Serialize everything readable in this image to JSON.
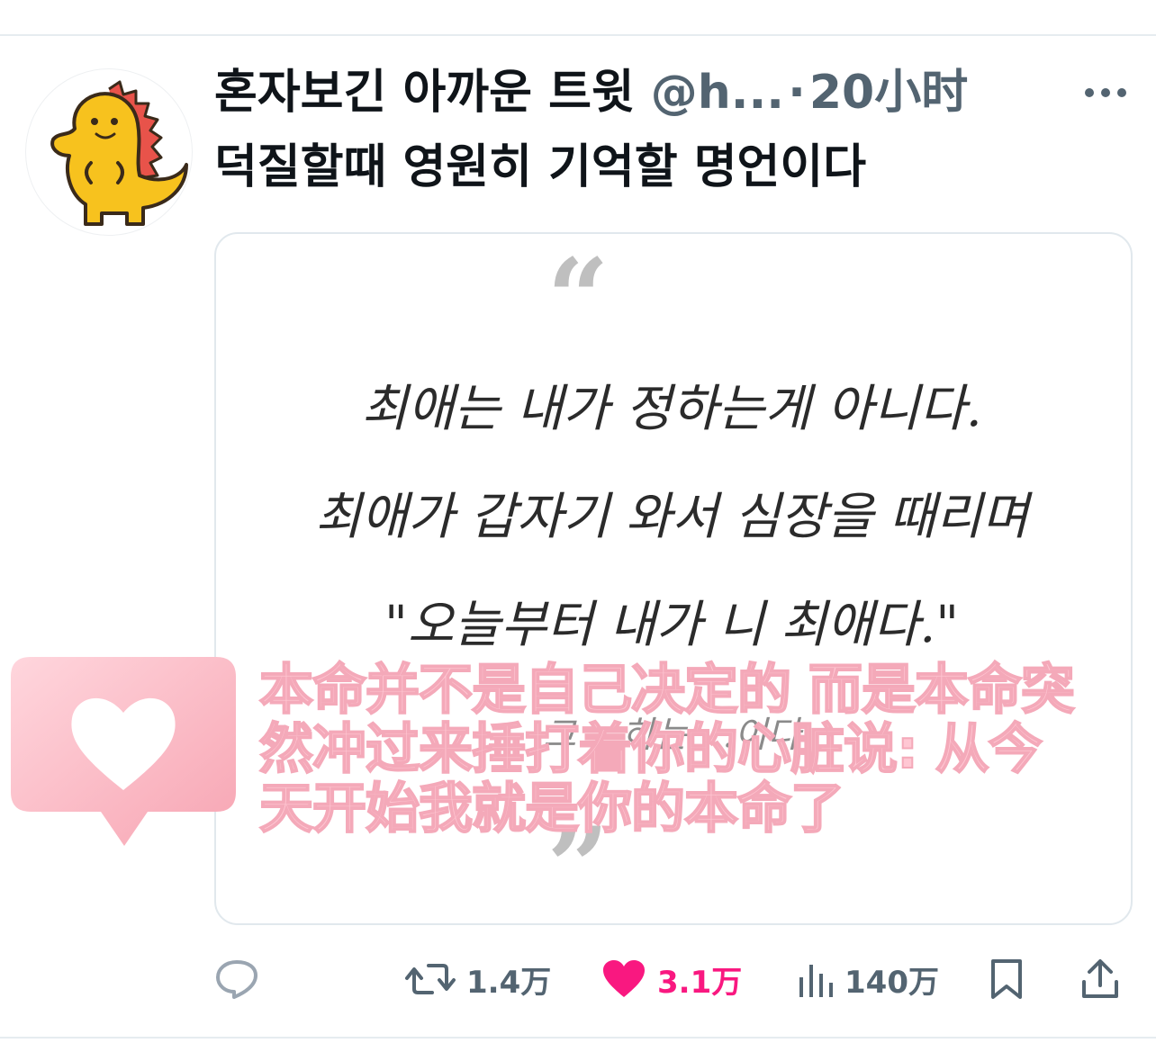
{
  "tweet": {
    "display_name": "혼자보긴 아까운 트윗",
    "handle": "@h...",
    "separator": "·",
    "time": "20小时",
    "text": "덕질할때 영원히 기억할 명언이다",
    "more_icon": "more-dots-icon",
    "avatar_icon": "yellow-dinosaur-avatar"
  },
  "media": {
    "quote_open": "“",
    "quote_close": "”",
    "korean_lines": [
      "최애는 내가 정하는게 아니다.",
      "최애가 갑자기 와서 심장을 때리며",
      "\"오늘부터 내가 니 최애다.\"",
      "그 ...하는 ...이다"
    ],
    "chinese_overlay": [
      "本命并不是自己决定的 而是本命突",
      "然冲过来捶打着你的心脏说: 从今",
      "天开始我就是你的本命了"
    ],
    "sticker_icon": "heart-speech-bubble-icon"
  },
  "actions": {
    "reply": {
      "icon": "reply-icon",
      "count": ""
    },
    "retweet": {
      "icon": "retweet-icon",
      "count": "1.4万"
    },
    "like": {
      "icon": "heart-filled-icon",
      "count": "3.1万",
      "color": "#f91880"
    },
    "views": {
      "icon": "views-bar-chart-icon",
      "count": "140万"
    },
    "bookmark": {
      "icon": "bookmark-icon"
    },
    "share": {
      "icon": "share-icon"
    }
  },
  "colors": {
    "text_primary": "#0f1419",
    "text_secondary": "#536471",
    "like_pink": "#f91880",
    "overlay_pink": "#ffc7d3"
  }
}
